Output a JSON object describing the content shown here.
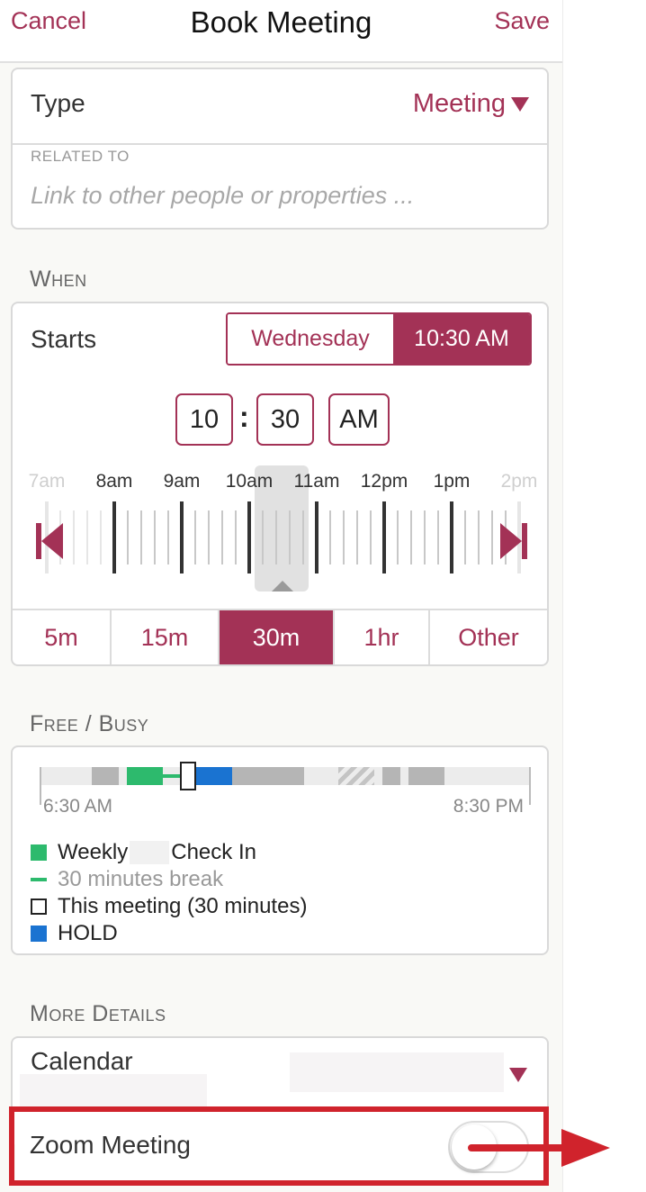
{
  "nav": {
    "cancel": "Cancel",
    "title": "Book Meeting",
    "save": "Save"
  },
  "type_card": {
    "type_label": "Type",
    "type_value": "Meeting",
    "type_icon": "triangle-down-icon",
    "related_label": "RELATED TO",
    "related_placeholder": "Link to other people or properties ..."
  },
  "when": {
    "header": "When",
    "starts_label": "Starts",
    "day": "Wednesday",
    "time": "10:30 AM",
    "hour": "10",
    "minute": "30",
    "ampm": "AM",
    "timeline_labels": [
      "7am",
      "8am",
      "9am",
      "10am",
      "11am",
      "12pm",
      "1pm",
      "2pm"
    ],
    "skip_back_icon": "skip-back-icon",
    "skip_forward_icon": "skip-forward-icon",
    "durations": [
      "5m",
      "15m",
      "30m",
      "1hr",
      "Other"
    ],
    "selected_duration": "30m"
  },
  "free_busy": {
    "header": "Free / Busy",
    "start_time": "6:30 AM",
    "end_time": "8:30 PM",
    "legend": {
      "weekly_prefix": "Weekly",
      "weekly_suffix": "Check In",
      "break": "30 minutes break",
      "this_meeting": "This meeting (30 minutes)",
      "hold": "HOLD"
    }
  },
  "more_details": {
    "header": "More Details",
    "calendar_label": "Calendar",
    "calendar_icon": "triangle-down-icon",
    "zoom_label": "Zoom Meeting",
    "zoom_enabled": false,
    "arrow_icon": "arrow-right-icon"
  },
  "colors": {
    "accent": "#a33256",
    "green": "#2dba6d",
    "blue": "#1a73d1",
    "busy_gray": "#b5b5b5",
    "highlight_red": "#d0232c"
  }
}
